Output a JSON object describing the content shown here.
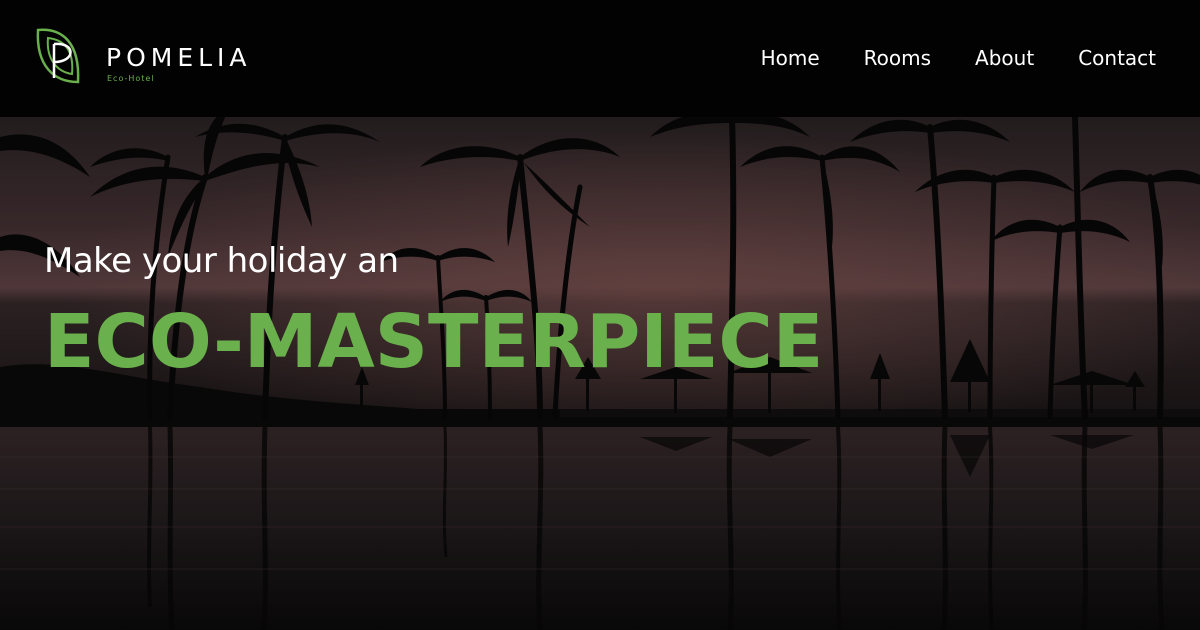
{
  "brand": {
    "name": "POMELIA",
    "subtitle": "Eco-Hotel",
    "color": "#6ab04c"
  },
  "nav": {
    "items": [
      {
        "label": "Home"
      },
      {
        "label": "Rooms"
      },
      {
        "label": "About"
      },
      {
        "label": "Contact"
      }
    ]
  },
  "hero": {
    "tagline": "Make your holiday an",
    "headline": "ECO-MASTERPIECE",
    "accent_color": "#6ab04c",
    "background": "palm-trees-pool-sunset"
  }
}
